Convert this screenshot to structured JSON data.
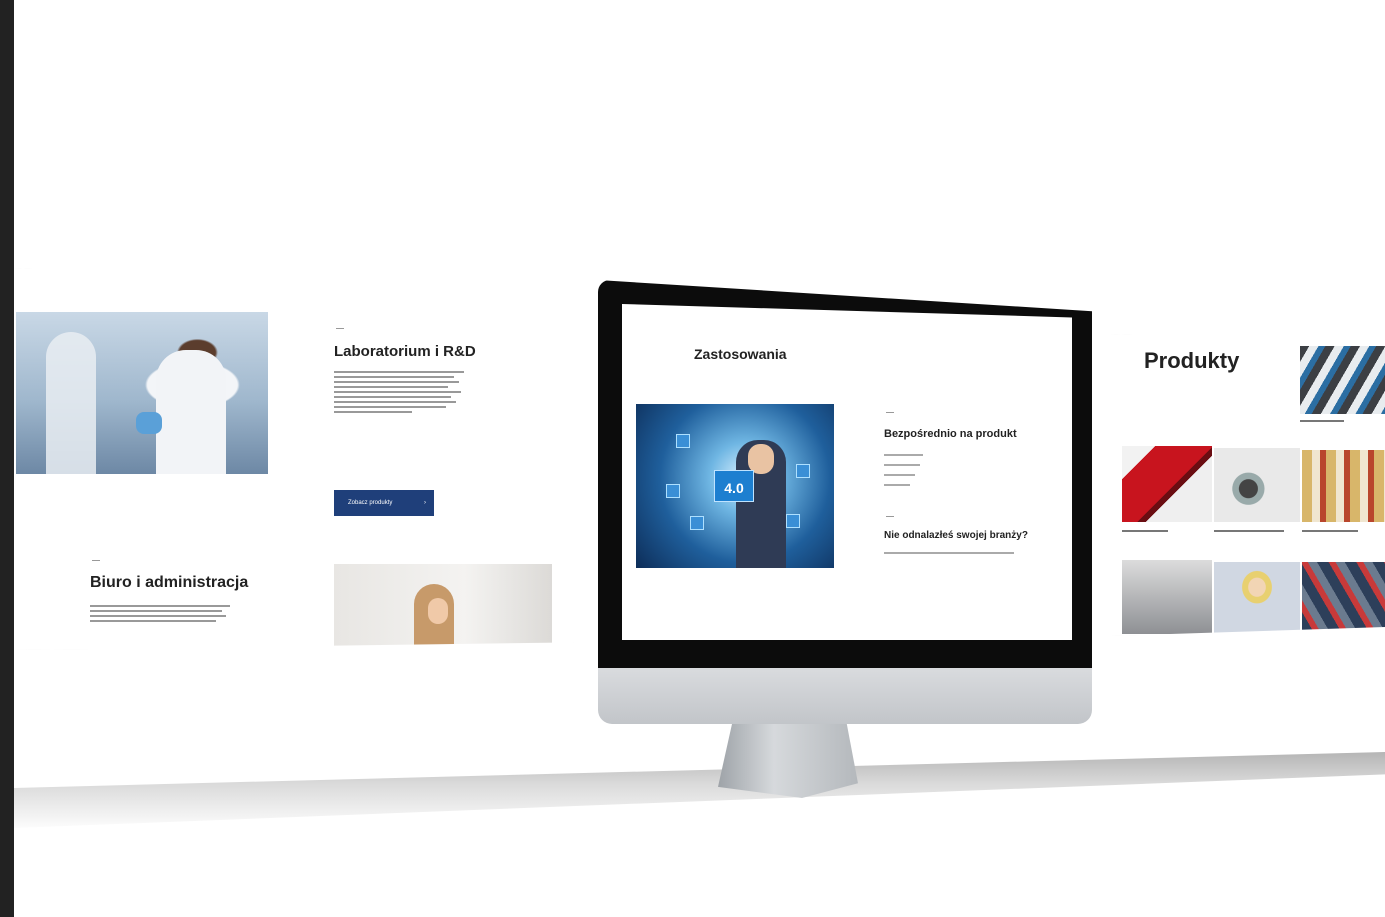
{
  "left_panel": {
    "lab_title": "Laboratorium i R&D",
    "lab_button": "Zobacz produkty",
    "office_title": "Biuro i administracja"
  },
  "monitor": {
    "title": "Zastosowania",
    "badge": "4.0",
    "heading": "Bezpośrednio na produkt",
    "question": "Nie odnalazłeś swojej branży?"
  },
  "right_panel": {
    "title": "Produkty"
  },
  "colors": {
    "brand_blue": "#1f3f7a",
    "text_dark": "#222222"
  }
}
